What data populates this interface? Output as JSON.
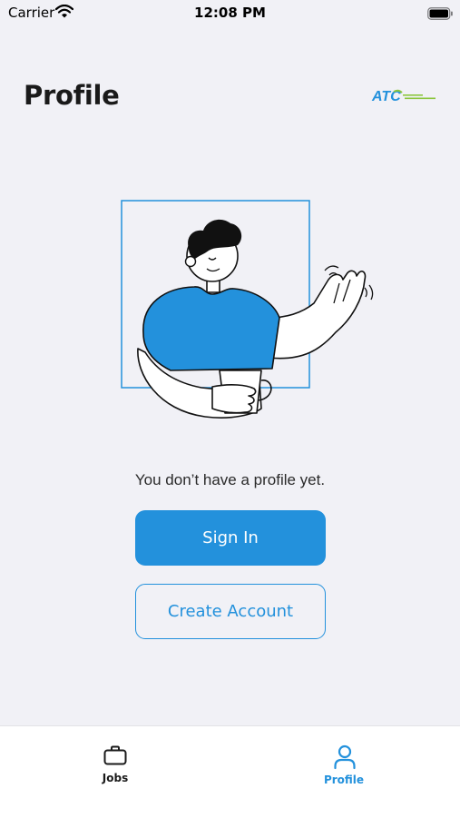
{
  "status_bar": {
    "carrier": "Carrier",
    "time": "12:08 PM",
    "wifi_icon": "wifi-icon",
    "battery_icon": "battery-icon"
  },
  "header": {
    "title": "Profile",
    "logo_text": "ATC"
  },
  "main": {
    "illustration": "waving-person-illustration",
    "empty_message": "You don’t have a profile yet.",
    "sign_in_label": "Sign In",
    "create_account_label": "Create Account"
  },
  "tab_bar": {
    "tabs": [
      {
        "label": "Jobs",
        "icon": "briefcase-icon",
        "active": false
      },
      {
        "label": "Profile",
        "icon": "person-icon",
        "active": true
      }
    ]
  },
  "colors": {
    "accent": "#2391dc",
    "background": "#f1f1f6",
    "tab_bar_background": "#ffffff",
    "logo_green": "#8cc63f",
    "text_dark": "#1a1a1a"
  }
}
